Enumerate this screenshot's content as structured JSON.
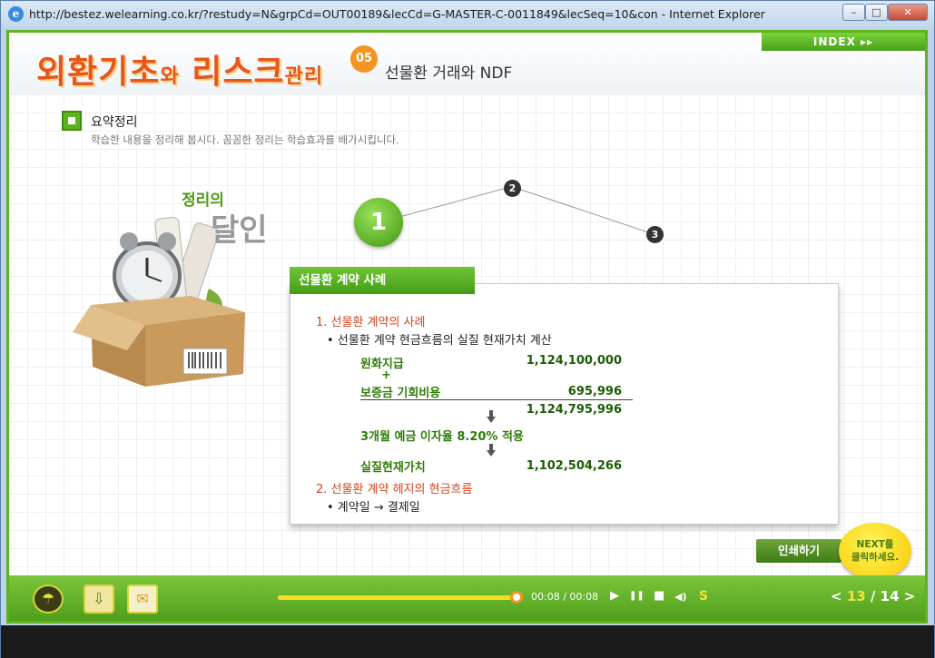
{
  "window": {
    "title": "http://bestez.welearning.co.kr/?restudy=N&grpCd=OUT00189&lecCd=G-MASTER-C-0011849&lecSeq=10&con - Internet Explorer",
    "minimize": "–",
    "maximize": "□",
    "close": "✕"
  },
  "header": {
    "brand_part1": "외환기초",
    "brand_wa": "와",
    "brand_part2": "리스크",
    "brand_small": "관리",
    "lesson_number": "05",
    "lesson_title": "선물환 거래와 NDF",
    "index_label": "INDEX ▸▸"
  },
  "section": {
    "title": "요약정리",
    "description": "학습한 내용을 정리해 봅시다. 꼼꼼한 정리는 학습효과를 배가시킵니다."
  },
  "illustration": {
    "line1": "정리의",
    "line2": "달인"
  },
  "steps": {
    "step1": "1",
    "step2": "2",
    "step3": "3"
  },
  "panel": {
    "header": "선물환 계약 사례",
    "item1_title": "1. 선물환 계약의 사례",
    "item1_bullet": "• 선물환 계약 현금흐름의 실질 현재가치 계산",
    "row1_label": "원화지급",
    "row1_value": "1,124,100,000",
    "plus": "+",
    "row2_label": "보증금 기회비용",
    "row2_value": "695,996",
    "total_value": "1,124,795,996",
    "rate_label": "3개월 예금 이자율 8.20% 적용",
    "pv_label": "실질현재가치",
    "pv_value": "1,102,504,266",
    "item2_title": "2. 선물환 계약 헤지의 현금흐름",
    "item2_bullet": "• 계약일 → 결제일"
  },
  "buttons": {
    "print": "인쇄하기",
    "next": "NEXT를\n클릭하세요."
  },
  "player": {
    "time": "00:08 / 00:08",
    "progress": 1.0,
    "play": "▶",
    "pause": "❚❚",
    "stop": "■",
    "volume": "◀)",
    "speed": "S",
    "page_prev": "<",
    "page_current": "13",
    "page_sep": "/",
    "page_total": "14",
    "page_next": ">"
  }
}
